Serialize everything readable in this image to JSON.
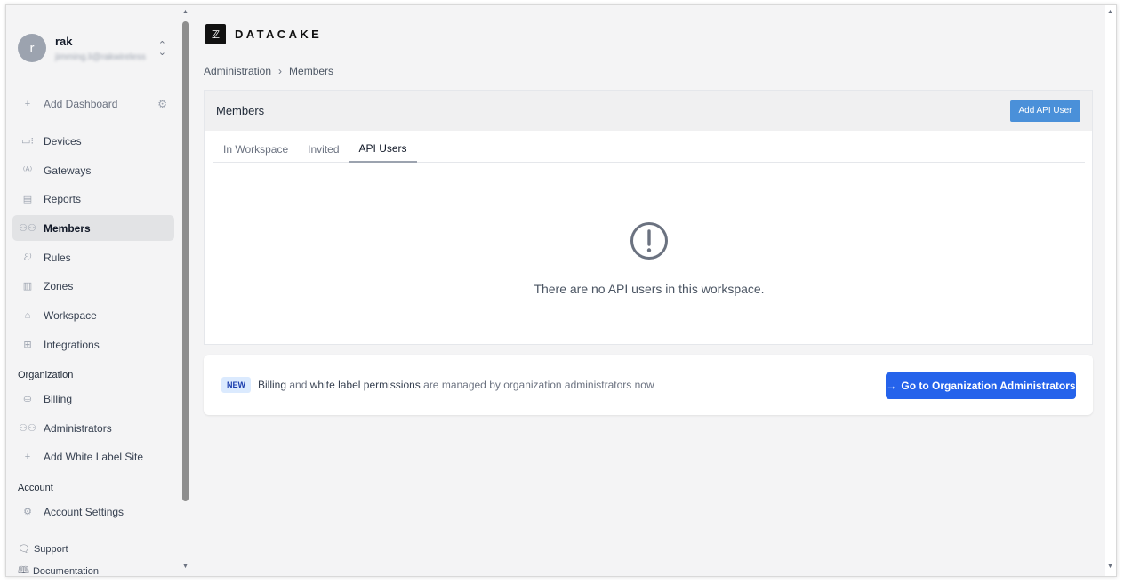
{
  "user": {
    "initial": "r",
    "name": "rak",
    "email": "jimming.li@rakwireless"
  },
  "sidebar": {
    "add_dashboard": "Add Dashboard",
    "items": [
      {
        "label": "Devices",
        "icon": "devices-icon"
      },
      {
        "label": "Gateways",
        "icon": "gateway-icon"
      },
      {
        "label": "Reports",
        "icon": "report-icon"
      },
      {
        "label": "Members",
        "icon": "members-icon",
        "active": true
      },
      {
        "label": "Rules",
        "icon": "rules-icon"
      },
      {
        "label": "Zones",
        "icon": "map-icon"
      },
      {
        "label": "Workspace",
        "icon": "home-icon"
      },
      {
        "label": "Integrations",
        "icon": "plus-square-icon"
      }
    ],
    "org_section": "Organization",
    "org_items": [
      {
        "label": "Billing",
        "icon": "billing-icon"
      },
      {
        "label": "Administrators",
        "icon": "members-icon"
      },
      {
        "label": "Add White Label Site",
        "icon": "plus-icon"
      }
    ],
    "account_section": "Account",
    "account_items": [
      {
        "label": "Account Settings",
        "icon": "gear-icon"
      }
    ],
    "footer": {
      "support": "Support",
      "documentation": "Documentation"
    }
  },
  "brand": {
    "name": "DATACAKE"
  },
  "breadcrumb": {
    "parent": "Administration",
    "current": "Members"
  },
  "panel": {
    "title": "Members",
    "add_button": "Add API User",
    "tabs": [
      "In Workspace",
      "Invited",
      "API Users"
    ],
    "active_tab": "API Users",
    "empty_message": "There are no API users in this workspace."
  },
  "notice": {
    "badge": "NEW",
    "billing": "Billing",
    "and": "and",
    "white_label": "white label permissions",
    "rest": "are managed by organization administrators now",
    "button": "Go to Organization Administrators"
  },
  "colors": {
    "accent": "#2563eb",
    "add_button": "#4a90d9",
    "badge_bg": "#dbeafe"
  }
}
